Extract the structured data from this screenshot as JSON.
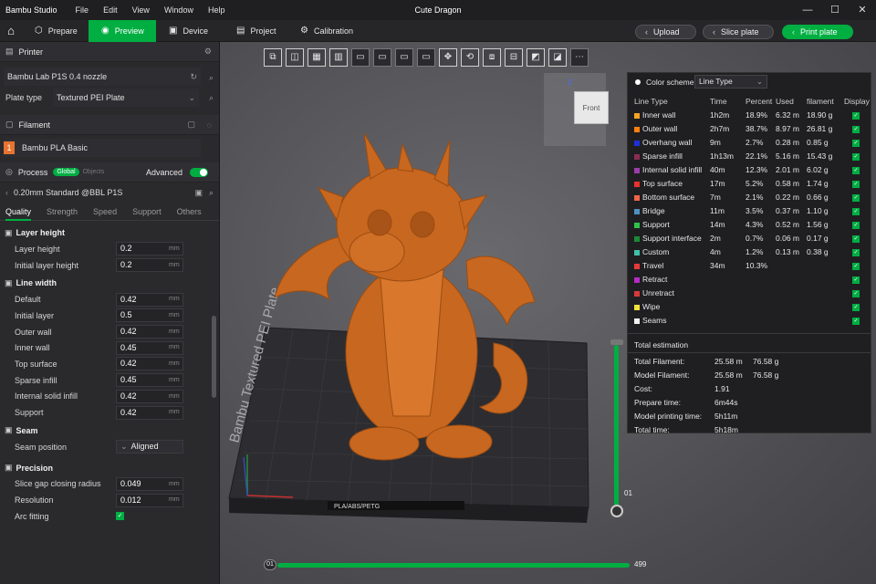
{
  "titlebar": {
    "app_name": "Bambu Studio",
    "menus": [
      "File",
      "Edit",
      "View",
      "Window",
      "Help"
    ],
    "document_title": "Cute Dragon"
  },
  "toolbar": {
    "tabs": [
      {
        "label": "Prepare",
        "icon": "cube-icon"
      },
      {
        "label": "Preview",
        "icon": "preview-icon",
        "active": true
      },
      {
        "label": "Device",
        "icon": "device-icon"
      },
      {
        "label": "Project",
        "icon": "project-icon"
      },
      {
        "label": "Calibration",
        "icon": "calibration-icon"
      }
    ],
    "upload_label": "Upload",
    "slice_label": "Slice plate",
    "print_label": "Print plate"
  },
  "printer": {
    "section_label": "Printer",
    "printer_name": "Bambu Lab P1S 0.4 nozzle",
    "plate_type_label": "Plate type",
    "plate_type_value": "Textured PEI Plate"
  },
  "filament": {
    "section_label": "Filament",
    "slot_number": "1",
    "filament_name": "Bambu PLA Basic"
  },
  "process": {
    "section_label": "Process",
    "global_label": "Global",
    "objects_label": "Objects",
    "advanced_label": "Advanced",
    "preset_name": "0.20mm Standard @BBL P1S",
    "subtabs": [
      "Quality",
      "Strength",
      "Speed",
      "Support",
      "Others"
    ]
  },
  "quality": {
    "layer_height_title": "Layer height",
    "layer_height": [
      {
        "label": "Layer height",
        "value": "0.2",
        "unit": "mm"
      },
      {
        "label": "Initial layer height",
        "value": "0.2",
        "unit": "mm"
      }
    ],
    "line_width_title": "Line width",
    "line_width": [
      {
        "label": "Default",
        "value": "0.42",
        "unit": "mm"
      },
      {
        "label": "Initial layer",
        "value": "0.5",
        "unit": "mm"
      },
      {
        "label": "Outer wall",
        "value": "0.42",
        "unit": "mm"
      },
      {
        "label": "Inner wall",
        "value": "0.45",
        "unit": "mm"
      },
      {
        "label": "Top surface",
        "value": "0.42",
        "unit": "mm"
      },
      {
        "label": "Sparse infill",
        "value": "0.45",
        "unit": "mm"
      },
      {
        "label": "Internal solid infill",
        "value": "0.42",
        "unit": "mm"
      },
      {
        "label": "Support",
        "value": "0.42",
        "unit": "mm"
      }
    ],
    "seam_title": "Seam",
    "seam_position_label": "Seam position",
    "seam_position_value": "Aligned",
    "precision_title": "Precision",
    "precision": [
      {
        "label": "Slice gap closing radius",
        "value": "0.049",
        "unit": "mm"
      },
      {
        "label": "Resolution",
        "value": "0.012",
        "unit": "mm"
      }
    ],
    "arc_fitting_label": "Arc fitting"
  },
  "viewport": {
    "plate_label": "Bambu Textured PEI Plate",
    "plate_badge": "PLA/ABS/PETG",
    "navcube_label": "Front",
    "axis_z_label": "Z",
    "slider_top_value": "01",
    "slider_h_start": "01",
    "slider_h_end": "499",
    "slider_h_progress": 1.0
  },
  "legend": {
    "color_scheme_label": "Color scheme",
    "color_scheme_value": "Line Type",
    "headers": [
      "Line Type",
      "Time",
      "Percent",
      "Used",
      "filament",
      "Display"
    ],
    "rows": [
      {
        "name": "Inner wall",
        "color": "#f7a323",
        "time": "1h2m",
        "percent": "18.9%",
        "used": "6.32 m",
        "filament": "18.90 g"
      },
      {
        "name": "Outer wall",
        "color": "#ff7f0e",
        "time": "2h7m",
        "percent": "38.7%",
        "used": "8.97 m",
        "filament": "26.81 g"
      },
      {
        "name": "Overhang wall",
        "color": "#1f2fd6",
        "time": "9m",
        "percent": "2.7%",
        "used": "0.28 m",
        "filament": "0.85 g"
      },
      {
        "name": "Sparse infill",
        "color": "#8b2d4f",
        "time": "1h13m",
        "percent": "22.1%",
        "used": "5.16 m",
        "filament": "15.43 g"
      },
      {
        "name": "Internal solid infill",
        "color": "#9b3da8",
        "time": "40m",
        "percent": "12.3%",
        "used": "2.01 m",
        "filament": "6.02 g"
      },
      {
        "name": "Top surface",
        "color": "#e8322e",
        "time": "17m",
        "percent": "5.2%",
        "used": "0.58 m",
        "filament": "1.74 g"
      },
      {
        "name": "Bottom surface",
        "color": "#f0654a",
        "time": "7m",
        "percent": "2.1%",
        "used": "0.22 m",
        "filament": "0.66 g"
      },
      {
        "name": "Bridge",
        "color": "#4f8fc0",
        "time": "11m",
        "percent": "3.5%",
        "used": "0.37 m",
        "filament": "1.10 g"
      },
      {
        "name": "Support",
        "color": "#2ec44a",
        "time": "14m",
        "percent": "4.3%",
        "used": "0.52 m",
        "filament": "1.56 g"
      },
      {
        "name": "Support interface",
        "color": "#1a8a35",
        "time": "2m",
        "percent": "0.7%",
        "used": "0.06 m",
        "filament": "0.17 g"
      },
      {
        "name": "Custom",
        "color": "#3fc0a8",
        "time": "4m",
        "percent": "1.2%",
        "used": "0.13 m",
        "filament": "0.38 g"
      },
      {
        "name": "Travel",
        "color": "#e63a3a",
        "time": "34m",
        "percent": "10.3%",
        "used": "",
        "filament": ""
      },
      {
        "name": "Retract",
        "color": "#b52cc4",
        "time": "",
        "percent": "",
        "used": "",
        "filament": ""
      },
      {
        "name": "Unretract",
        "color": "#d83a3a",
        "time": "",
        "percent": "",
        "used": "",
        "filament": ""
      },
      {
        "name": "Wipe",
        "color": "#f2e23a",
        "time": "",
        "percent": "",
        "used": "",
        "filament": ""
      },
      {
        "name": "Seams",
        "color": "#f0f0f0",
        "time": "",
        "percent": "",
        "used": "",
        "filament": ""
      }
    ],
    "total_title": "Total estimation",
    "totals": [
      {
        "label": "Total Filament:",
        "v1": "25.58 m",
        "v2": "76.58 g"
      },
      {
        "label": "Model Filament:",
        "v1": "25.58 m",
        "v2": "76.58 g"
      },
      {
        "label": "Cost:",
        "v1": "1.91",
        "v2": ""
      },
      {
        "label": "Prepare time:",
        "v1": "6m44s",
        "v2": ""
      },
      {
        "label": "Model printing time:",
        "v1": "5h11m",
        "v2": ""
      },
      {
        "label": "Total time:",
        "v1": "5h18m",
        "v2": ""
      }
    ]
  }
}
